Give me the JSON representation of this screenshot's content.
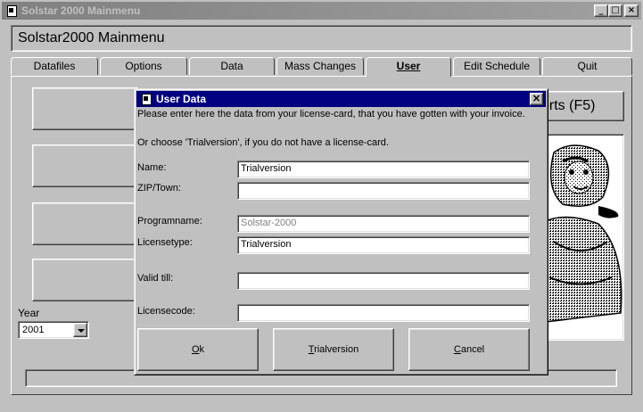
{
  "window": {
    "title": "Solstar 2000 Mainmenu",
    "header": "Solstar2000 Mainmenu",
    "controls": {
      "minimize": "_",
      "maximize": "□",
      "close": "×"
    }
  },
  "tabs": [
    {
      "label": "Datafiles"
    },
    {
      "label": "Options"
    },
    {
      "label": "Data"
    },
    {
      "label": "Mass Changes"
    },
    {
      "label": "User"
    },
    {
      "label": "Edit Schedule"
    },
    {
      "label": "Quit"
    }
  ],
  "active_tab": "User",
  "reports_button": "orts (F5)",
  "year": {
    "label": "Year",
    "value": "2001"
  },
  "dialog": {
    "title": "User Data",
    "close_label": "×",
    "instruction1": "Please enter here the data from your license-card, that you have gotten with your invoice.",
    "instruction2": "Or choose 'Trialversion', if you do not have a license-card.",
    "fields": {
      "name": {
        "label": "Name:",
        "value": "Trialversion"
      },
      "zip_town": {
        "label": "ZIP/Town:",
        "value": ""
      },
      "programname": {
        "label": "Programname:",
        "value": "Solstar-2000"
      },
      "licensetype": {
        "label": "Licensetype:",
        "value": "Trialversion"
      },
      "valid_till": {
        "label": "Valid till:",
        "value": ""
      },
      "licensecode": {
        "label": "Licensecode:",
        "value": ""
      }
    },
    "buttons": {
      "ok": {
        "label": "Ok",
        "accel": "O"
      },
      "trial": {
        "label": "Trialversion",
        "accel": "T"
      },
      "cancel": {
        "label": "Cancel",
        "accel": "C"
      }
    }
  },
  "colors": {
    "face": "#c0c0c0",
    "dialog_title": "#000080",
    "inactive_title": "#808080"
  }
}
